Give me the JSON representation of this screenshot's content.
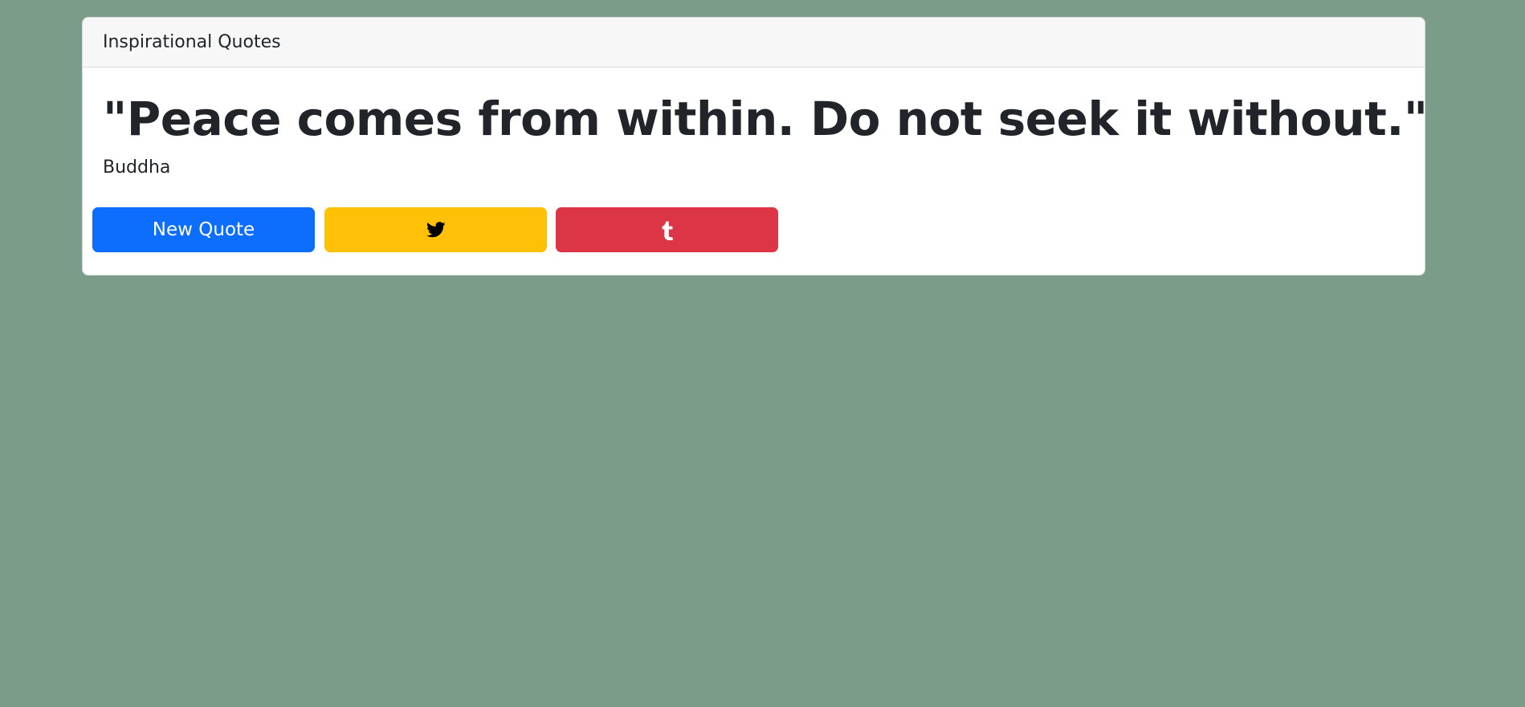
{
  "header": {
    "title": "Inspirational Quotes"
  },
  "quote": {
    "text": "\"Peace comes from within. Do not seek it without.\"",
    "author": "Buddha"
  },
  "buttons": {
    "new_quote_label": "New Quote",
    "tweet_icon": "twitter-icon",
    "tumblr_icon": "tumblr-icon"
  },
  "colors": {
    "background": "#7b9c88",
    "new_quote_button": "#0d6efd",
    "tweet_button": "#ffc107",
    "tumblr_button": "#dc3545"
  }
}
